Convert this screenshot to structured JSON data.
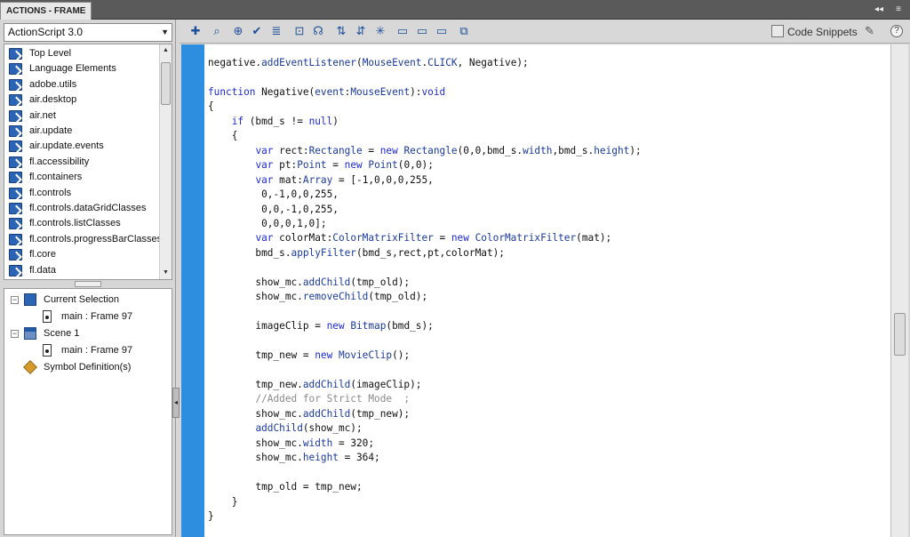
{
  "panel": {
    "title": "ACTIONS - FRAME",
    "controls": [
      "◂◂",
      "≡"
    ]
  },
  "language_select": {
    "value": "ActionScript 3.0"
  },
  "toolbox": {
    "items": [
      "Top Level",
      "Language Elements",
      "adobe.utils",
      "air.desktop",
      "air.net",
      "air.update",
      "air.update.events",
      "fl.accessibility",
      "fl.containers",
      "fl.controls",
      "fl.controls.dataGridClasses",
      "fl.controls.listClasses",
      "fl.controls.progressBarClasses",
      "fl.core",
      "fl.data"
    ]
  },
  "script_navigator": {
    "current_selection": "Current Selection",
    "current_frame": "main : Frame 97",
    "scene": "Scene 1",
    "scene_frame": "main : Frame 97",
    "symbols": "Symbol Definition(s)"
  },
  "editor_toolbar": {
    "code_snippets_label": "Code Snippets",
    "help_label": "?"
  },
  "code": {
    "lines": [
      [
        [
          "negative.",
          ""
        ],
        [
          "addEventListener",
          "ty"
        ],
        [
          "(",
          ""
        ],
        [
          "MouseEvent",
          "ty"
        ],
        [
          ".",
          ""
        ],
        [
          "CLICK",
          "ty"
        ],
        [
          ", Negative);",
          ""
        ]
      ],
      [
        [
          "",
          ""
        ]
      ],
      [
        [
          "function",
          "kw"
        ],
        [
          " Negative(",
          ""
        ],
        [
          "event",
          "ty"
        ],
        [
          ":",
          ""
        ],
        [
          "MouseEvent",
          "ty"
        ],
        [
          "):",
          ""
        ],
        [
          "void",
          "kw"
        ]
      ],
      [
        [
          "{",
          ""
        ]
      ],
      [
        [
          "    ",
          ""
        ],
        [
          "if",
          "kw"
        ],
        [
          " (bmd_s != ",
          ""
        ],
        [
          "null",
          "kw"
        ],
        [
          ")",
          ""
        ]
      ],
      [
        [
          "    {",
          ""
        ]
      ],
      [
        [
          "        ",
          ""
        ],
        [
          "var",
          "kw"
        ],
        [
          " rect:",
          ""
        ],
        [
          "Rectangle",
          "ty"
        ],
        [
          " = ",
          ""
        ],
        [
          "new",
          "kw"
        ],
        [
          " ",
          ""
        ],
        [
          "Rectangle",
          "ty"
        ],
        [
          "(0,0,bmd_s.",
          ""
        ],
        [
          "width",
          "ty"
        ],
        [
          ",bmd_s.",
          ""
        ],
        [
          "height",
          "ty"
        ],
        [
          ");",
          ""
        ]
      ],
      [
        [
          "        ",
          ""
        ],
        [
          "var",
          "kw"
        ],
        [
          " pt:",
          ""
        ],
        [
          "Point",
          "ty"
        ],
        [
          " = ",
          ""
        ],
        [
          "new",
          "kw"
        ],
        [
          " ",
          ""
        ],
        [
          "Point",
          "ty"
        ],
        [
          "(0,0);",
          ""
        ]
      ],
      [
        [
          "        ",
          ""
        ],
        [
          "var",
          "kw"
        ],
        [
          " mat:",
          ""
        ],
        [
          "Array",
          "ty"
        ],
        [
          " = [-1,0,0,0,255,",
          ""
        ]
      ],
      [
        [
          "         0,-1,0,0,255,",
          ""
        ]
      ],
      [
        [
          "         0,0,-1,0,255,",
          ""
        ]
      ],
      [
        [
          "         0,0,0,1,0];",
          ""
        ]
      ],
      [
        [
          "        ",
          ""
        ],
        [
          "var",
          "kw"
        ],
        [
          " colorMat:",
          ""
        ],
        [
          "ColorMatrixFilter",
          "ty"
        ],
        [
          " = ",
          ""
        ],
        [
          "new",
          "kw"
        ],
        [
          " ",
          ""
        ],
        [
          "ColorMatrixFilter",
          "ty"
        ],
        [
          "(mat);",
          ""
        ]
      ],
      [
        [
          "        bmd_s.",
          ""
        ],
        [
          "applyFilter",
          "ty"
        ],
        [
          "(bmd_s,rect,pt,colorMat);",
          ""
        ]
      ],
      [
        [
          "",
          ""
        ]
      ],
      [
        [
          "        show_mc.",
          ""
        ],
        [
          "addChild",
          "ty"
        ],
        [
          "(tmp_old);",
          ""
        ]
      ],
      [
        [
          "        show_mc.",
          ""
        ],
        [
          "removeChild",
          "ty"
        ],
        [
          "(tmp_old);",
          ""
        ]
      ],
      [
        [
          "",
          ""
        ]
      ],
      [
        [
          "        imageClip = ",
          ""
        ],
        [
          "new",
          "kw"
        ],
        [
          " ",
          ""
        ],
        [
          "Bitmap",
          "ty"
        ],
        [
          "(bmd_s);",
          ""
        ]
      ],
      [
        [
          "",
          ""
        ]
      ],
      [
        [
          "        tmp_new = ",
          ""
        ],
        [
          "new",
          "kw"
        ],
        [
          " ",
          ""
        ],
        [
          "MovieClip",
          "ty"
        ],
        [
          "();",
          ""
        ]
      ],
      [
        [
          "",
          ""
        ]
      ],
      [
        [
          "        tmp_new.",
          ""
        ],
        [
          "addChild",
          "ty"
        ],
        [
          "(imageClip);",
          ""
        ]
      ],
      [
        [
          "        ",
          ""
        ],
        [
          "//Added for Strict Mode  ;",
          "cm"
        ]
      ],
      [
        [
          "        show_mc.",
          ""
        ],
        [
          "addChild",
          "ty"
        ],
        [
          "(tmp_new);",
          ""
        ]
      ],
      [
        [
          "        ",
          ""
        ],
        [
          "addChild",
          "ty"
        ],
        [
          "(show_mc);",
          ""
        ]
      ],
      [
        [
          "        show_mc.",
          ""
        ],
        [
          "width",
          "ty"
        ],
        [
          " = 320;",
          ""
        ]
      ],
      [
        [
          "        show_mc.",
          ""
        ],
        [
          "height",
          "ty"
        ],
        [
          " = 364;",
          ""
        ]
      ],
      [
        [
          "",
          ""
        ]
      ],
      [
        [
          "        tmp_old = tmp_new;",
          ""
        ]
      ],
      [
        [
          "    }",
          ""
        ]
      ],
      [
        [
          "}",
          ""
        ]
      ]
    ]
  }
}
